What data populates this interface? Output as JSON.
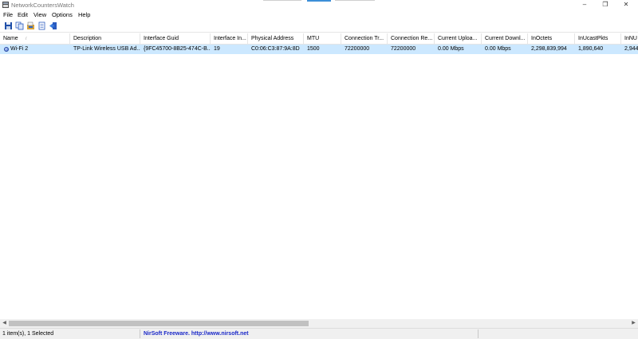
{
  "window": {
    "title": "NetworkCountersWatch",
    "controls": {
      "minimize": "–",
      "maximize": "❐",
      "close": "✕"
    }
  },
  "menu": [
    "File",
    "Edit",
    "View",
    "Options",
    "Help"
  ],
  "toolbar": [
    "save-icon",
    "copy-icon",
    "properties-icon",
    "html-report-icon",
    "exit-icon"
  ],
  "columns": [
    "Name",
    "Description",
    "Interface Guid",
    "Interface In...",
    "Physical Address",
    "MTU",
    "Connection Tr...",
    "Connection Re...",
    "Current Uploa...",
    "Current Downl...",
    "InOctets",
    "InUcastPkts",
    "InNU"
  ],
  "sort_indicator": "/",
  "rows": [
    [
      "Wi-Fi 2",
      "TP-Link Wireless USB Ad...",
      "{9FC45700-8B25-474C-B...",
      "19",
      "C0:06:C3:87:9A:8D",
      "1500",
      "72200000",
      "72200000",
      "0.00 Mbps",
      "0.00 Mbps",
      "2,298,839,994",
      "1,890,640",
      "2,944"
    ]
  ],
  "scrollbar": {
    "left": "◀",
    "right": "▶"
  },
  "status": {
    "items": "1 item(s), 1 Selected",
    "freeware": "NirSoft Freeware.  http://www.nirsoft.net"
  },
  "colors": {
    "selection": "#cce8ff",
    "link": "#1a28c8"
  }
}
